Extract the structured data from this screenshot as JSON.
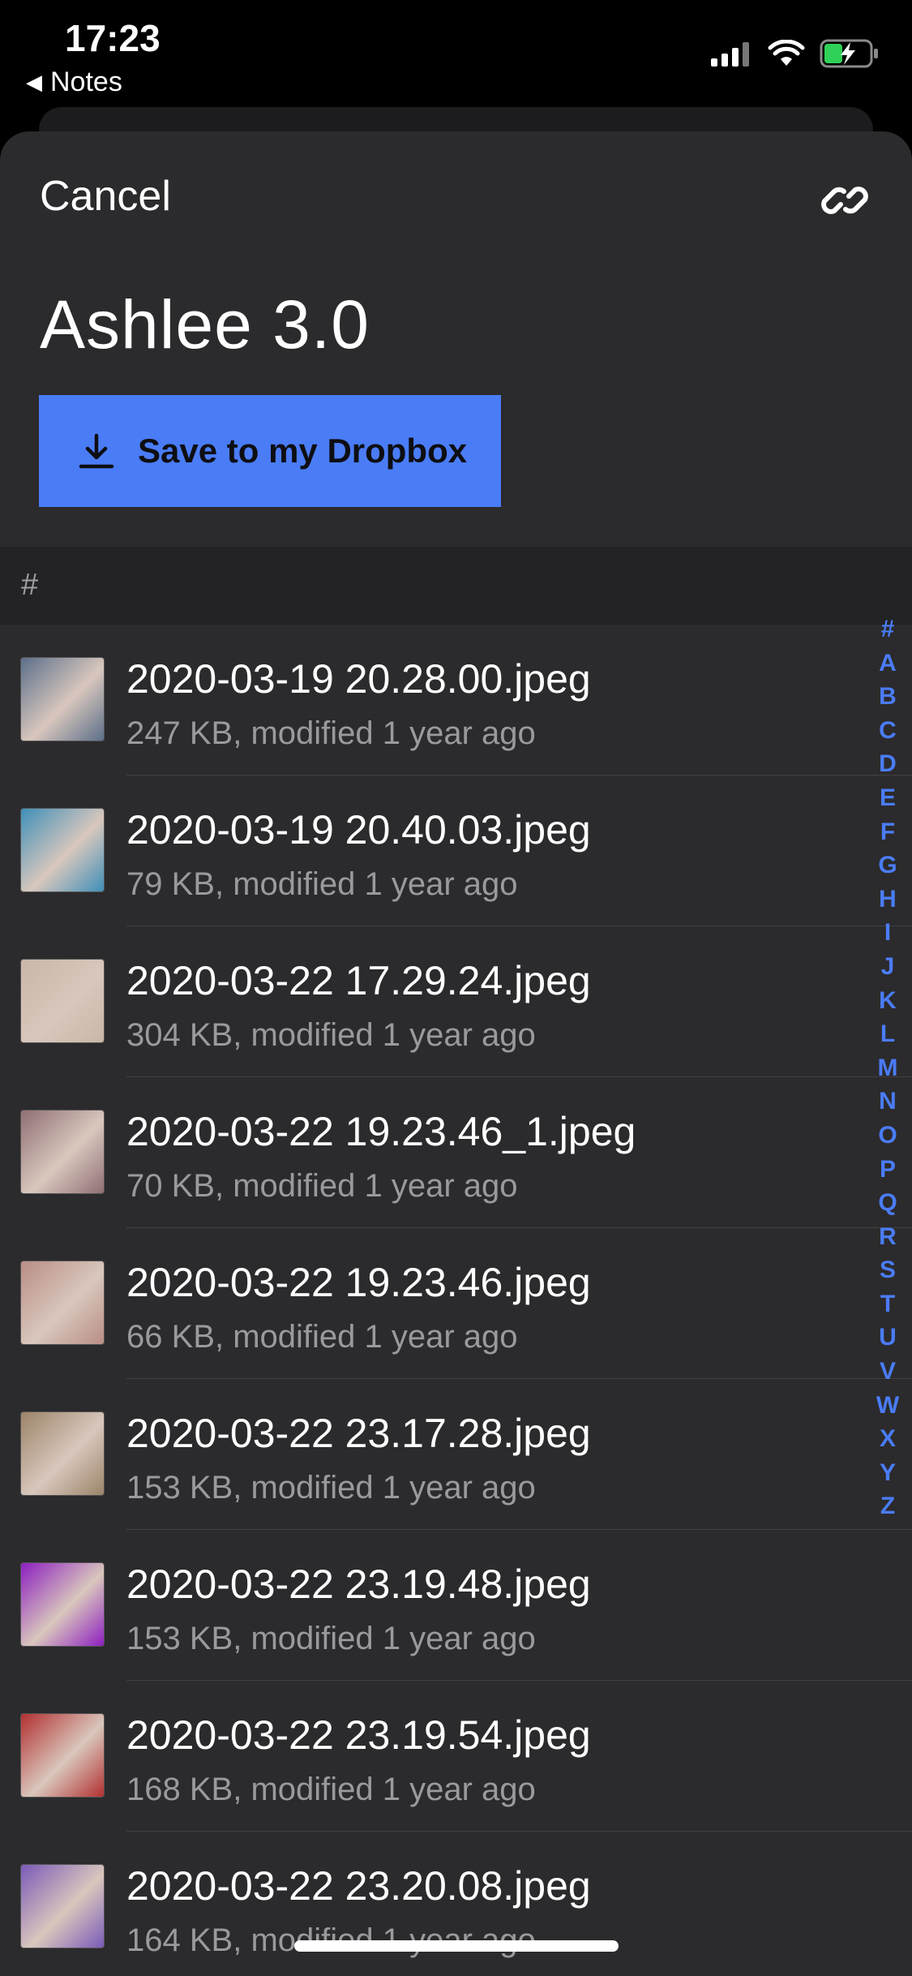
{
  "status_bar": {
    "time": "17:23",
    "back_label": "Notes"
  },
  "header": {
    "cancel_label": "Cancel",
    "title": "Ashlee 3.0"
  },
  "actions": {
    "save_label": "Save to my Dropbox"
  },
  "section": {
    "label": "#"
  },
  "files": [
    {
      "name": "2020-03-19 20.28.00.jpeg",
      "meta": "247 KB, modified 1 year ago",
      "thumb_color": "#5b6f8a"
    },
    {
      "name": "2020-03-19 20.40.03.jpeg",
      "meta": "79 KB, modified 1 year ago",
      "thumb_color": "#3f8fb8"
    },
    {
      "name": "2020-03-22 17.29.24.jpeg",
      "meta": "304 KB, modified 1 year ago",
      "thumb_color": "#c9b7a8"
    },
    {
      "name": "2020-03-22 19.23.46_1.jpeg",
      "meta": "70 KB, modified 1 year ago",
      "thumb_color": "#8f6f74"
    },
    {
      "name": "2020-03-22 19.23.46.jpeg",
      "meta": "66 KB, modified 1 year ago",
      "thumb_color": "#b98e86"
    },
    {
      "name": "2020-03-22 23.17.28.jpeg",
      "meta": "153 KB, modified 1 year ago",
      "thumb_color": "#9b8468"
    },
    {
      "name": "2020-03-22 23.19.48.jpeg",
      "meta": "153 KB, modified 1 year ago",
      "thumb_color": "#8d1fc0"
    },
    {
      "name": "2020-03-22 23.19.54.jpeg",
      "meta": "168 KB, modified 1 year ago",
      "thumb_color": "#b23030"
    },
    {
      "name": "2020-03-22 23.20.08.jpeg",
      "meta": "164 KB, modified 1 year ago",
      "thumb_color": "#7a5ab8"
    }
  ],
  "index_letters": [
    "#",
    "A",
    "B",
    "C",
    "D",
    "E",
    "F",
    "G",
    "H",
    "I",
    "J",
    "K",
    "L",
    "M",
    "N",
    "O",
    "P",
    "Q",
    "R",
    "S",
    "T",
    "U",
    "V",
    "W",
    "X",
    "Y",
    "Z"
  ],
  "colors": {
    "accent": "#4a7cf6",
    "sheet_bg": "#2b2a2c"
  }
}
